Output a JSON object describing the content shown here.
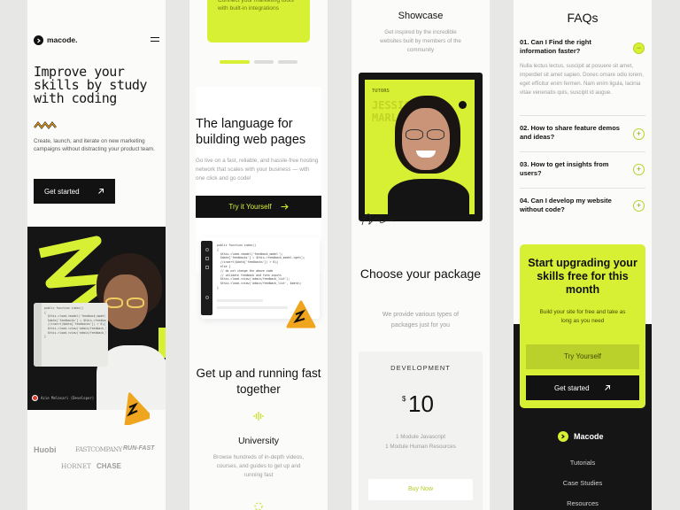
{
  "col1": {
    "logo": "macode.",
    "hero_title": "Improve your skills by study with coding",
    "hero_desc": "Create, launch, and iterate on new marketing campaigns without distracting your product team.",
    "cta": "Get started",
    "caption": "Azie Melasari (Developer)",
    "code_snippet": "public function index()\n{\n  $this->load->model('feedback_model');\n  $data['feedbacks'] = $this->feedback_model->get();\n  //insert($data['feedbacks']) > 0){\n  $this->load->view('admin/feedback_list')\n  $this->load->view('admin/feedback_list')\n}",
    "brands": [
      "Huobi",
      "FASTCOMPANY",
      "RUN-FAST",
      "HORNET",
      "CHASE"
    ]
  },
  "col2": {
    "top_text": "Connect your marketing tools with built-in integrations",
    "h_language": "The language for building web pages",
    "language_desc": "Go live on a fast, reliable, and hassle-free hosting network that scales with your business — with one click and go code!",
    "try_btn": "Try it Yourself",
    "code_snippet": "public function index()\n{\n  $this->load->model('feedback_model');\n  $data['feedbacks'] = $this->feedback_model->get();\n  //insert($data['feedbacks']) > 0){\n  else {\n  // do not change the above code\n  // validate feedback and form inputs\n  $this->load->view('admin/feedback_list');\n  $this->load->view('admin/feedback_list', $data);\n}",
    "h_running": "Get up and running fast together",
    "univ_title": "University",
    "univ_desc": "Browse hundreds of in-depth videos, courses, and guides to get up and running fast"
  },
  "col3": {
    "showcase_title": "Showcase",
    "showcase_desc": "Get inspired by the incredible websites built by members of the community",
    "tutor_label": "TUTORS",
    "tutor_name_1": "JESSICA",
    "tutor_name_2": "MARLEY",
    "h_choose": "Choose your package",
    "choose_desc": "We provide various types of packages just for you",
    "plan_name": "DEVELOPMENT",
    "currency": "$",
    "price": "10",
    "feat1": "1 Module Javascript",
    "feat2": "1 Module Human Resources",
    "buy_btn": "Buy Now"
  },
  "col4": {
    "faq_title": "FAQs",
    "faqs": [
      {
        "q": "01. Can I Find the right information faster?",
        "a": "Nulla lectus lectus, suscipit at posuere sit amet, imperdiet sit amet sapien. Donec ornare odio lorem, eget efficitur enim fermen. Nam enim ligula, lacinia vitae venenatis quis, suscipit id augue.",
        "toggle": "−"
      },
      {
        "q": "02. How to share feature demos and ideas?",
        "toggle": "+"
      },
      {
        "q": "03. How to get insights from users?",
        "toggle": "+"
      },
      {
        "q": "04. Can I develop my website without code?",
        "toggle": "+"
      }
    ],
    "cta_title": "Start upgrading your skills free for this month",
    "cta_desc": "Build your site for free and take as long as you need",
    "try_btn": "Try Yourself",
    "start_btn": "Get started",
    "footer_logo": "Macode",
    "footer_links": [
      "Tutorials",
      "Case Studies",
      "Resources"
    ]
  },
  "colors": {
    "accent": "#d8f034",
    "dark": "#151515",
    "orange": "#f0a51e"
  },
  "icons": [
    "hamburger-icon",
    "arrow-up-right-icon",
    "arrow-right-icon",
    "plus-icon",
    "minus-icon",
    "soundwave-icon",
    "logo-chevron-icon"
  ]
}
